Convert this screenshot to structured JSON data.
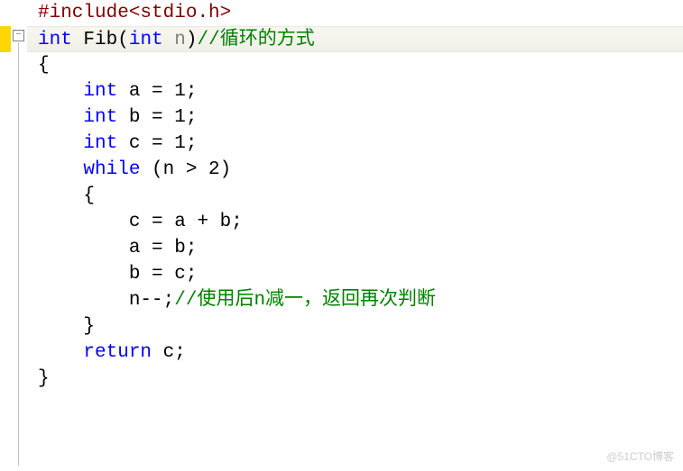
{
  "gutter": {
    "fold_glyph": "−"
  },
  "code": {
    "l1": {
      "include": "#include",
      "header": "<stdio.h>"
    },
    "l2": {
      "kw_int": "int",
      "fn": " Fib",
      "open": "(",
      "kw_int2": "int",
      "param": " n",
      "close": ")",
      "comment": "//循环的方式"
    },
    "l3": {
      "brace": "{"
    },
    "l4": {
      "indent": "    ",
      "kw": "int",
      "rest": " a = 1;"
    },
    "l5": {
      "indent": "    ",
      "kw": "int",
      "rest": " b = 1;"
    },
    "l6": {
      "indent": "    ",
      "kw": "int",
      "rest": " c = 1;"
    },
    "l7": {
      "indent": "    ",
      "kw": "while",
      "cond": " (n > 2)"
    },
    "l8": {
      "indent": "    ",
      "brace": "{"
    },
    "l9": {
      "indent": "        ",
      "stmt": "c = a + b;"
    },
    "l10": {
      "indent": "        ",
      "stmt": "a = b;"
    },
    "l11": {
      "indent": "        ",
      "stmt": "b = c;"
    },
    "l12": {
      "indent": "        ",
      "stmt": "n--;",
      "comment": "//使用后n减一，返回再次判断"
    },
    "l13": {
      "indent": "    ",
      "brace": "}"
    },
    "l14": {
      "indent": "    ",
      "kw": "return",
      "rest": " c;"
    },
    "l15": {
      "brace": "}"
    }
  },
  "watermark": "@51CTO博客"
}
